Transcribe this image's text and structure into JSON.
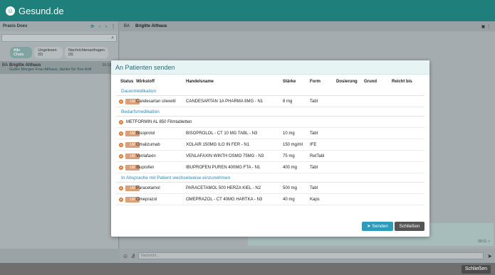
{
  "app": {
    "title": "Gesund.de"
  },
  "left": {
    "practice": "Praxis Doex",
    "filters": [
      {
        "label": "Alle Chats"
      },
      {
        "label": "Ungelesen (0)"
      },
      {
        "label": "Nachrichtenanfragen (0)"
      }
    ],
    "chat": {
      "initials": "BA",
      "name": "Brigitte Althaus",
      "time": "29.10.20",
      "message": "Guten Morgen Frau Althaus, danke für Ihre Anfr"
    }
  },
  "chat": {
    "initials": "BA",
    "name": "Brigitte Althaus",
    "bubble_time": "09:11 ✓",
    "composer_placeholder": "Nachricht..."
  },
  "bottom": {
    "close_label": "Schließen"
  },
  "modal": {
    "title": "An Patienten senden",
    "columns": {
      "status": "Status",
      "wirkstoff": "Wirkstoff",
      "handelsname": "Handelsname",
      "staerke": "Stärke",
      "form": "Form",
      "dosierung": "Dosierung",
      "grund": "Grund",
      "reicht_bis": "Reicht bis"
    },
    "sections": [
      "Dauermedikation",
      "Bedarfsmedikation",
      "In Absprache mit Patient wechselweise einzunehmen"
    ],
    "rows": [
      {
        "badge": "LM",
        "wirkstoff": "Candesartan cilexetil",
        "handelsname": "CANDESARTAN 1A PHARMA 8MG - N1",
        "staerke": "8 mg",
        "form": "Tabl"
      },
      {
        "wirkstoff": "METFORMIN AL 850 Filmtabletten"
      },
      {
        "badge": "LM",
        "wirkstoff": "Bisoprolol",
        "handelsname": "BISOPROLOL - CT 10 MG TABL - N3",
        "staerke": "10 mg",
        "form": "Tabl"
      },
      {
        "badge": "LM",
        "wirkstoff": "Omalizumab",
        "handelsname": "XOLAIR 150MG ILO IN FER - N1",
        "staerke": "150 mg/ml",
        "form": "IFE"
      },
      {
        "badge": "LM",
        "wirkstoff": "Venlafaxin",
        "handelsname": "VENLAFAXIN WINTH OSMO 75MG - N3",
        "staerke": "75 mg",
        "form": "RetTabl"
      },
      {
        "badge": "LM",
        "wirkstoff": "Ibuprofen",
        "handelsname": "IBUPROFEN PUREN 400MG FTA - N1",
        "staerke": "400 mg",
        "form": "Tabl"
      },
      {
        "badge": "LM",
        "wirkstoff": "Paracetamol",
        "handelsname": "PARACETAMOL 500 HERZA KIEL - N2",
        "staerke": "500 mg",
        "form": "Tabl"
      },
      {
        "badge": "LM",
        "wirkstoff": "Omeprazol",
        "handelsname": "OMEPRAZOL - CT 40MG HARTKA - N3",
        "staerke": "40 mg",
        "form": "Kaps"
      }
    ],
    "send_label": "Senden",
    "close_label": "Schließen"
  }
}
